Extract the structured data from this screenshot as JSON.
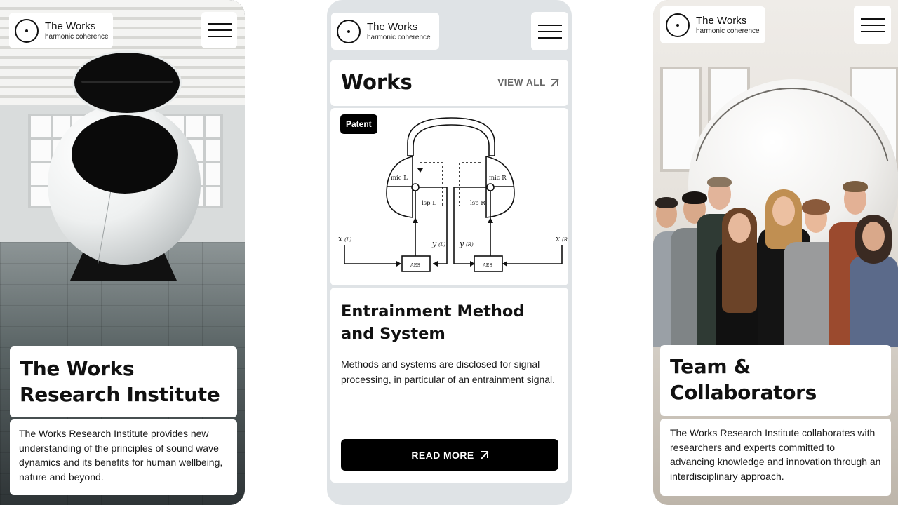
{
  "brand": {
    "name": "The Works",
    "tagline": "harmonic coherence"
  },
  "icons": {
    "logo": "circle-dot-logo-icon",
    "menu": "hamburger-menu-icon",
    "external": "arrow-up-right-icon"
  },
  "colors": {
    "primary": "#000000",
    "card_bg": "#ffffff",
    "panel_gray": "#dfe3e6",
    "muted_text": "#666666"
  },
  "screen1": {
    "title": "The Works Research Institute",
    "description": "The Works Research Institute provides new understanding of the principles of sound wave dynamics and its benefits for human wellbeing, nature and beyond."
  },
  "screen2": {
    "section_title": "Works",
    "view_all_label": "VIEW ALL",
    "badge": "Patent",
    "diagram": {
      "mic_left": "mic L",
      "mic_right": "mic R",
      "lsp_left": "lsp L",
      "lsp_right": "lsp R",
      "x_left": "x",
      "x_left_sub": "(L)",
      "x_right": "x",
      "x_right_sub": "(R)",
      "y_left": "y",
      "y_left_sub": "(L)",
      "y_right": "y",
      "y_right_sub": "(R)",
      "box_left": "AES",
      "box_right": "AES"
    },
    "item_title": "Entrainment Method and System",
    "item_description": "Methods and systems are disclosed for signal processing, in particular of an entrainment signal.",
    "read_more_label": "READ MORE"
  },
  "screen3": {
    "title": "Team & Collaborators",
    "description": "The Works Research Institute collaborates with researchers and experts committed to advancing knowledge and innovation through an interdisciplinary approach."
  }
}
